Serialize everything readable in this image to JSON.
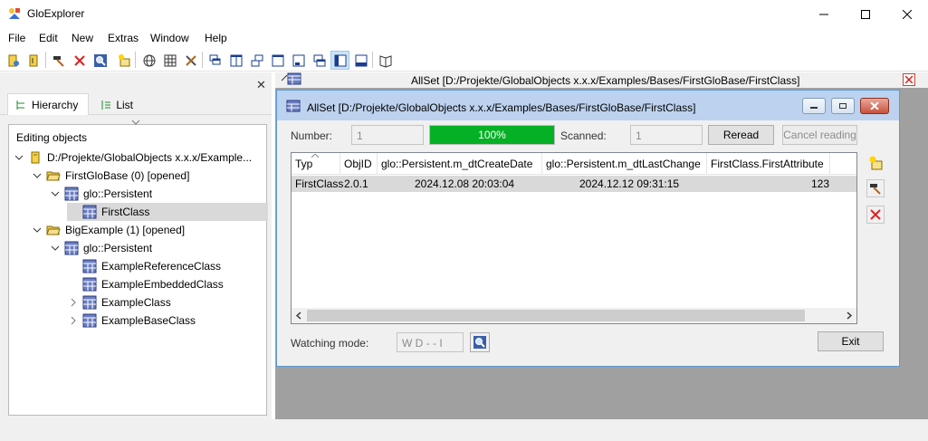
{
  "window": {
    "title": "GloExplorer"
  },
  "menu": [
    "File",
    "Edit",
    "New",
    "Extras",
    "Window",
    "Help"
  ],
  "left_pane": {
    "tabs": [
      {
        "label": "Hierarchy",
        "selected": true
      },
      {
        "label": "List",
        "selected": false
      }
    ],
    "caption": "Editing objects",
    "tree": [
      {
        "label": "D:/Projekte/GlobalObjects x.x.x/Example...",
        "icon": "database-icon",
        "twisty": "expanded"
      },
      {
        "label": "FirstGloBase (0) [opened]",
        "icon": "folder-open-icon",
        "twisty": "expanded"
      },
      {
        "label": "glo::Persistent",
        "icon": "class-table-icon",
        "twisty": "expanded"
      },
      {
        "label": "FirstClass",
        "icon": "class-table-icon",
        "twisty": "none",
        "selected": true
      },
      {
        "label": "BigExample (1) [opened]",
        "icon": "folder-open-icon",
        "twisty": "expanded"
      },
      {
        "label": "glo::Persistent",
        "icon": "class-table-icon",
        "twisty": "expanded"
      },
      {
        "label": "ExampleReferenceClass",
        "icon": "class-table-icon",
        "twisty": "none"
      },
      {
        "label": "ExampleEmbeddedClass",
        "icon": "class-table-icon",
        "twisty": "none"
      },
      {
        "label": "ExampleClass",
        "icon": "class-table-icon",
        "twisty": "collapsed"
      },
      {
        "label": "ExampleBaseClass",
        "icon": "class-table-icon",
        "twisty": "collapsed"
      }
    ]
  },
  "mdi_tab": {
    "title": "AllSet [D:/Projekte/GlobalObjects x.x.x/Examples/Bases/FirstGloBase/FirstClass]"
  },
  "child": {
    "title": "AllSet [D:/Projekte/GlobalObjects x.x.x/Examples/Bases/FirstGloBase/FirstClass]",
    "number_label": "Number:",
    "number_value": "1",
    "progress_text": "100%",
    "progress_fraction": 1.0,
    "scanned_label": "Scanned:",
    "scanned_value": "1",
    "reread_label": "Reread",
    "cancel_label": "Cancel reading",
    "columns": [
      "Typ",
      "ObjID",
      "glo::Persistent.m_dtCreateDate",
      "glo::Persistent.m_dtLastChange",
      "FirstClass.FirstAttribute"
    ],
    "rows": [
      [
        "FirstClass",
        "2.0.1",
        "2024.12.08 20:03:04",
        "2024.12.12 09:31:15",
        "123"
      ]
    ],
    "watching_label": "Watching mode:",
    "watching_value": "W D - - I",
    "exit_label": "Exit"
  },
  "colors": {
    "progress": "#06b025",
    "child_title": "#bcd2ee",
    "mdi_bg": "#a0a0a0",
    "selection": "#d9d9d9"
  }
}
